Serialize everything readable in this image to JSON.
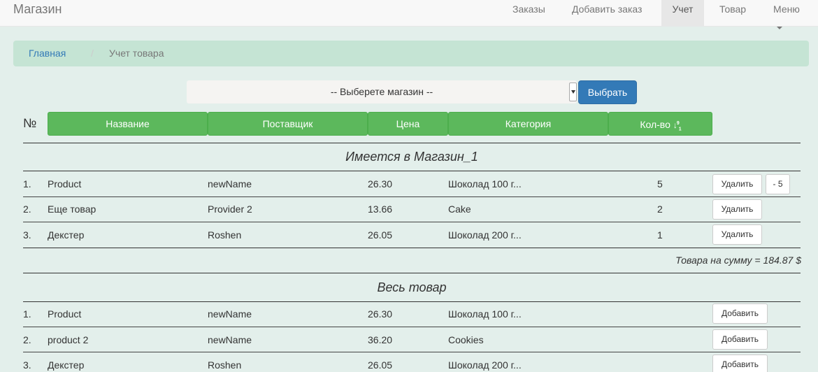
{
  "navbar": {
    "brand": "Магазин",
    "items": [
      "Заказы",
      "Добавить заказ",
      "Учет",
      "Товар",
      "Меню"
    ]
  },
  "breadcrumb": {
    "home": "Главная",
    "separator": "/",
    "current": "Учет товара"
  },
  "store_select": {
    "value": "-- Выберете магазин --",
    "button": "Выбрать"
  },
  "table": {
    "number_header": "№",
    "columns": [
      "Название",
      "Поставщик",
      "Цена",
      "Категория",
      "Кол-во"
    ]
  },
  "in_store": {
    "title": "Имеется в Магазин_1",
    "rows": [
      {
        "num": "1.",
        "name": "Product",
        "supplier": "newName",
        "price": "26.30",
        "category": "Шоколад 100 г...",
        "qty": "5",
        "delete": "Удалить",
        "minus": "- 5"
      },
      {
        "num": "2.",
        "name": "Еще товар",
        "supplier": "Provider 2",
        "price": "13.66",
        "category": "Cake",
        "qty": "2",
        "delete": "Удалить"
      },
      {
        "num": "3.",
        "name": "Декстер",
        "supplier": "Roshen",
        "price": "26.05",
        "category": "Шоколад 200 г...",
        "qty": "1",
        "delete": "Удалить"
      }
    ],
    "total": "Товара на сумму = 184.87 $"
  },
  "all_goods": {
    "title": "Весь товар",
    "rows": [
      {
        "num": "1.",
        "name": "Product",
        "supplier": "newName",
        "price": "26.30",
        "category": "Шоколад 100 г...",
        "add": "Добавить"
      },
      {
        "num": "2.",
        "name": "product 2",
        "supplier": "newName",
        "price": "36.20",
        "category": "Cookies",
        "add": "Добавить"
      },
      {
        "num": "3.",
        "name": "Декстер",
        "supplier": "Roshen",
        "price": "26.05",
        "category": "Шоколад 200 г...",
        "add": "Добавить"
      }
    ]
  },
  "colors": {
    "table_header": "#5cb85c",
    "primary": "#337ab7",
    "breadcrumb_bg": "#c5e4d4",
    "page_bg": "#e3efeb"
  },
  "icons": [
    "caret-down-icon",
    "sort-numeric-icon",
    "select-arrow-icon"
  ]
}
